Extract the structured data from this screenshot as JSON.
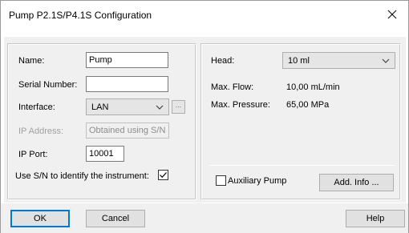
{
  "window": {
    "title": "Pump P2.1S/P4.1S Configuration",
    "close_glyph": "close-icon"
  },
  "left_panel": {
    "name_label": "Name:",
    "name_value": "Pump",
    "serial_label": "Serial Number:",
    "serial_value": "",
    "interface_label": "Interface:",
    "interface_value": "LAN",
    "interface_browse_label": "...",
    "ip_address_label": "IP Address:",
    "ip_address_value": "Obtained using S/N",
    "ip_port_label": "IP Port:",
    "ip_port_value": "10001",
    "use_sn_label": "Use S/N to identify the instrument:",
    "use_sn_checked": true
  },
  "right_panel": {
    "head_label": "Head:",
    "head_value": "10 ml",
    "max_flow_label": "Max. Flow:",
    "max_flow_value": "10,00 mL/min",
    "max_pressure_label": "Max. Pressure:",
    "max_pressure_value": "65,00 MPa",
    "aux_pump_label": "Auxiliary Pump",
    "aux_pump_checked": false,
    "add_info_label": "Add. Info ..."
  },
  "footer": {
    "ok_label": "OK",
    "cancel_label": "Cancel",
    "help_label": "Help"
  },
  "colors": {
    "default_button_border": "#0078d7",
    "dialog_background": "#f0f0f0",
    "disabled_text": "#a0a0a0"
  }
}
